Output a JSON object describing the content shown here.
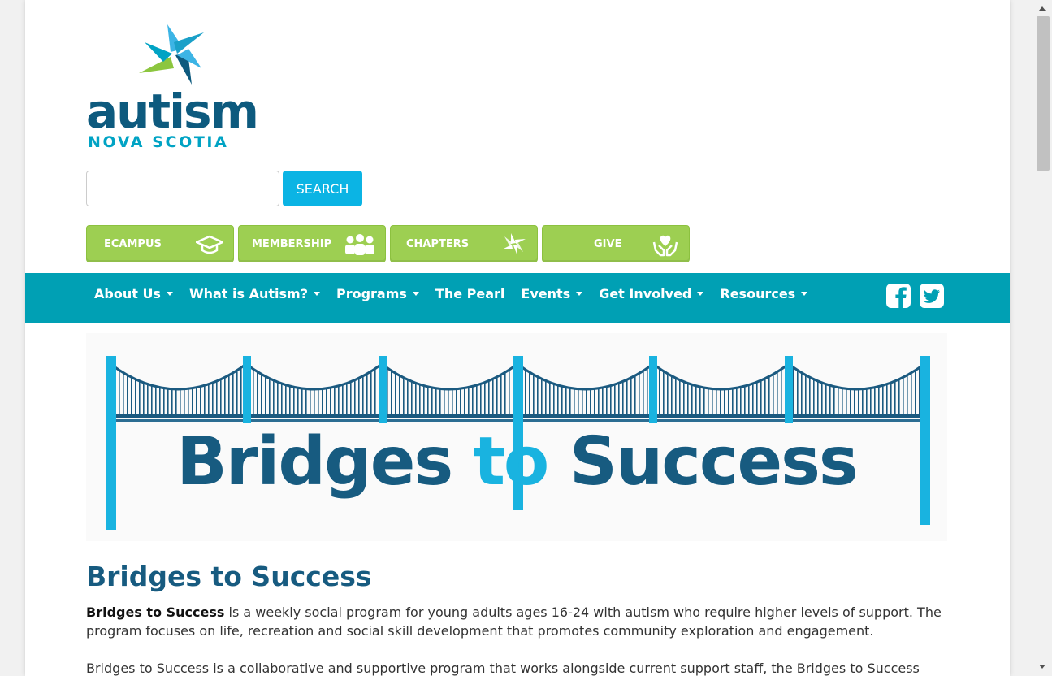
{
  "logo": {
    "word": "autism",
    "subtitle": "NOVA SCOTIA"
  },
  "search": {
    "button_label": "SEARCH",
    "value": ""
  },
  "quick_links": [
    {
      "label": "ECAMPUS",
      "icon": "graduation-cap-icon"
    },
    {
      "label": "MEMBERSHIP",
      "icon": "people-icon"
    },
    {
      "label": "CHAPTERS",
      "icon": "pinwheel-icon"
    },
    {
      "label": "GIVE",
      "icon": "heart-hands-icon"
    }
  ],
  "nav": {
    "items": [
      {
        "label": "About Us",
        "dropdown": true
      },
      {
        "label": "What is Autism?",
        "dropdown": true
      },
      {
        "label": "Programs",
        "dropdown": true
      },
      {
        "label": "The Pearl",
        "dropdown": false
      },
      {
        "label": "Events",
        "dropdown": true
      },
      {
        "label": "Get Involved",
        "dropdown": true
      },
      {
        "label": "Resources",
        "dropdown": true
      }
    ],
    "social": [
      "facebook-icon",
      "twitter-icon"
    ]
  },
  "banner": {
    "title_part1": "Bridges ",
    "title_part2": "to",
    "title_part3": " Success"
  },
  "content": {
    "title": "Bridges to Success",
    "para1_bold": "Bridges to Success",
    "para1_text": " is a weekly social program for young adults ages 16-24 with autism who require higher levels of support. The program focuses on life, recreation and social skill development that promotes community exploration and engagement.",
    "para2_text": "Bridges to Success is a collaborative and supportive program that works alongside current support staff, the Bridges to Success Coordinator"
  },
  "colors": {
    "brand_dark": "#175b80",
    "brand_light": "#19b3e0",
    "nav_bg": "#00a0b4",
    "quick_link_green": "#9dcf52",
    "search_button": "#0bb4e4"
  }
}
